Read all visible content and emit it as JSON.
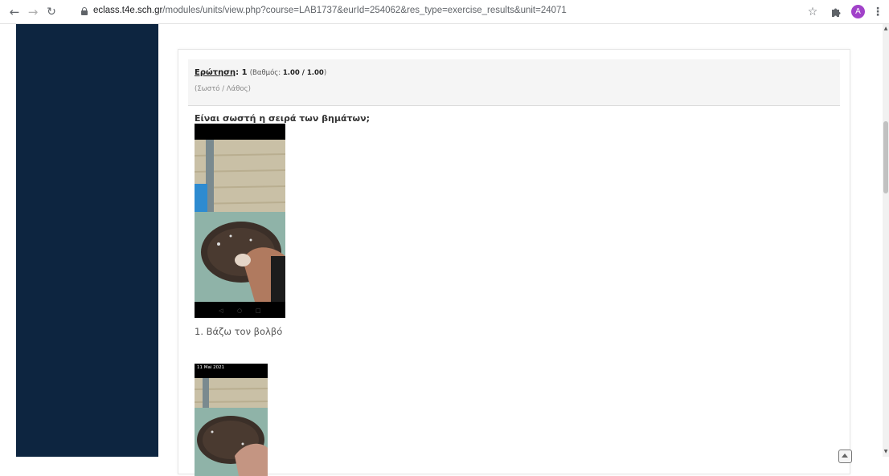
{
  "browser": {
    "url_host": "eclass.t4e.sch.gr",
    "url_path": "/modules/units/view.php?course=LAB1737&eurId=254062&res_type=exercise_results&unit=24071",
    "avatar_letter": "A"
  },
  "question": {
    "label": "Ερώτηση",
    "number": ": 1",
    "grade_prefix": "(Βαθμός: ",
    "grade_value": "1.00 / 1.00",
    "grade_suffix": ")",
    "type": "(Σωστό / Λάθος)",
    "text": "Είναι σωστή η σειρά των βημάτων;"
  },
  "steps": [
    {
      "caption": "1. Βάζω τον βολβό"
    },
    {
      "caption": "",
      "photo_date": "11 Mai 2021"
    }
  ],
  "colors": {
    "sidebar": "#0d2540",
    "avatar": "#a142c9"
  }
}
